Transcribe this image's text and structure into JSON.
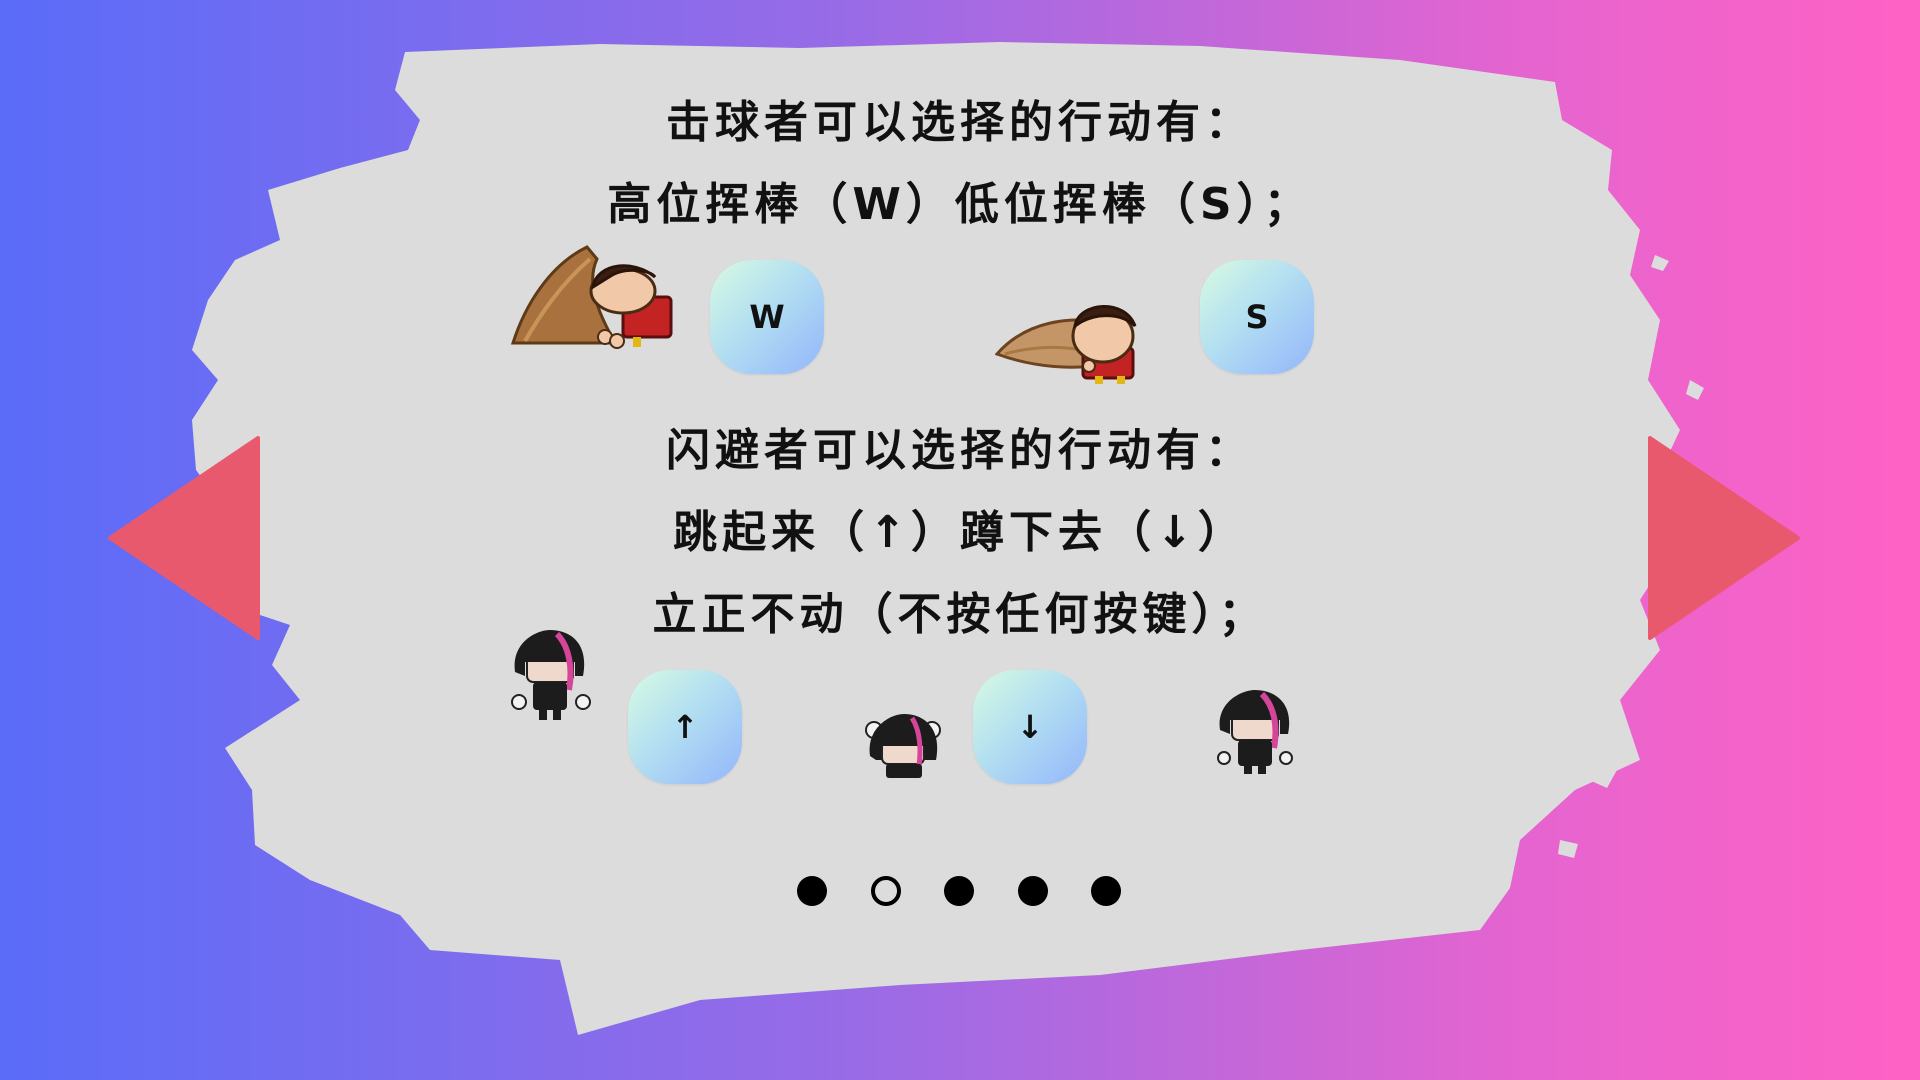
{
  "slide": {
    "hitter_heading": "击球者可以选择的行动有：",
    "hitter_actions": "高位挥棒（W）低位挥棒（S）；",
    "dodger_heading": "闪避者可以选择的行动有：",
    "dodger_actions_1": "跳起来（↑）蹲下去（↓）",
    "dodger_actions_2": "立正不动（不按任何按键）；"
  },
  "keys": {
    "w": "W",
    "s": "S",
    "up": "↑",
    "down": "↓"
  },
  "pagination": {
    "total": 5,
    "current": 2
  },
  "colors": {
    "arrow": "#e8596e",
    "panel": "#dcdcdc",
    "gradient_left": "#5a6cf8",
    "gradient_right": "#ff62c4"
  },
  "icons": {
    "prev": "triangle-left-icon",
    "next": "triangle-right-icon"
  }
}
